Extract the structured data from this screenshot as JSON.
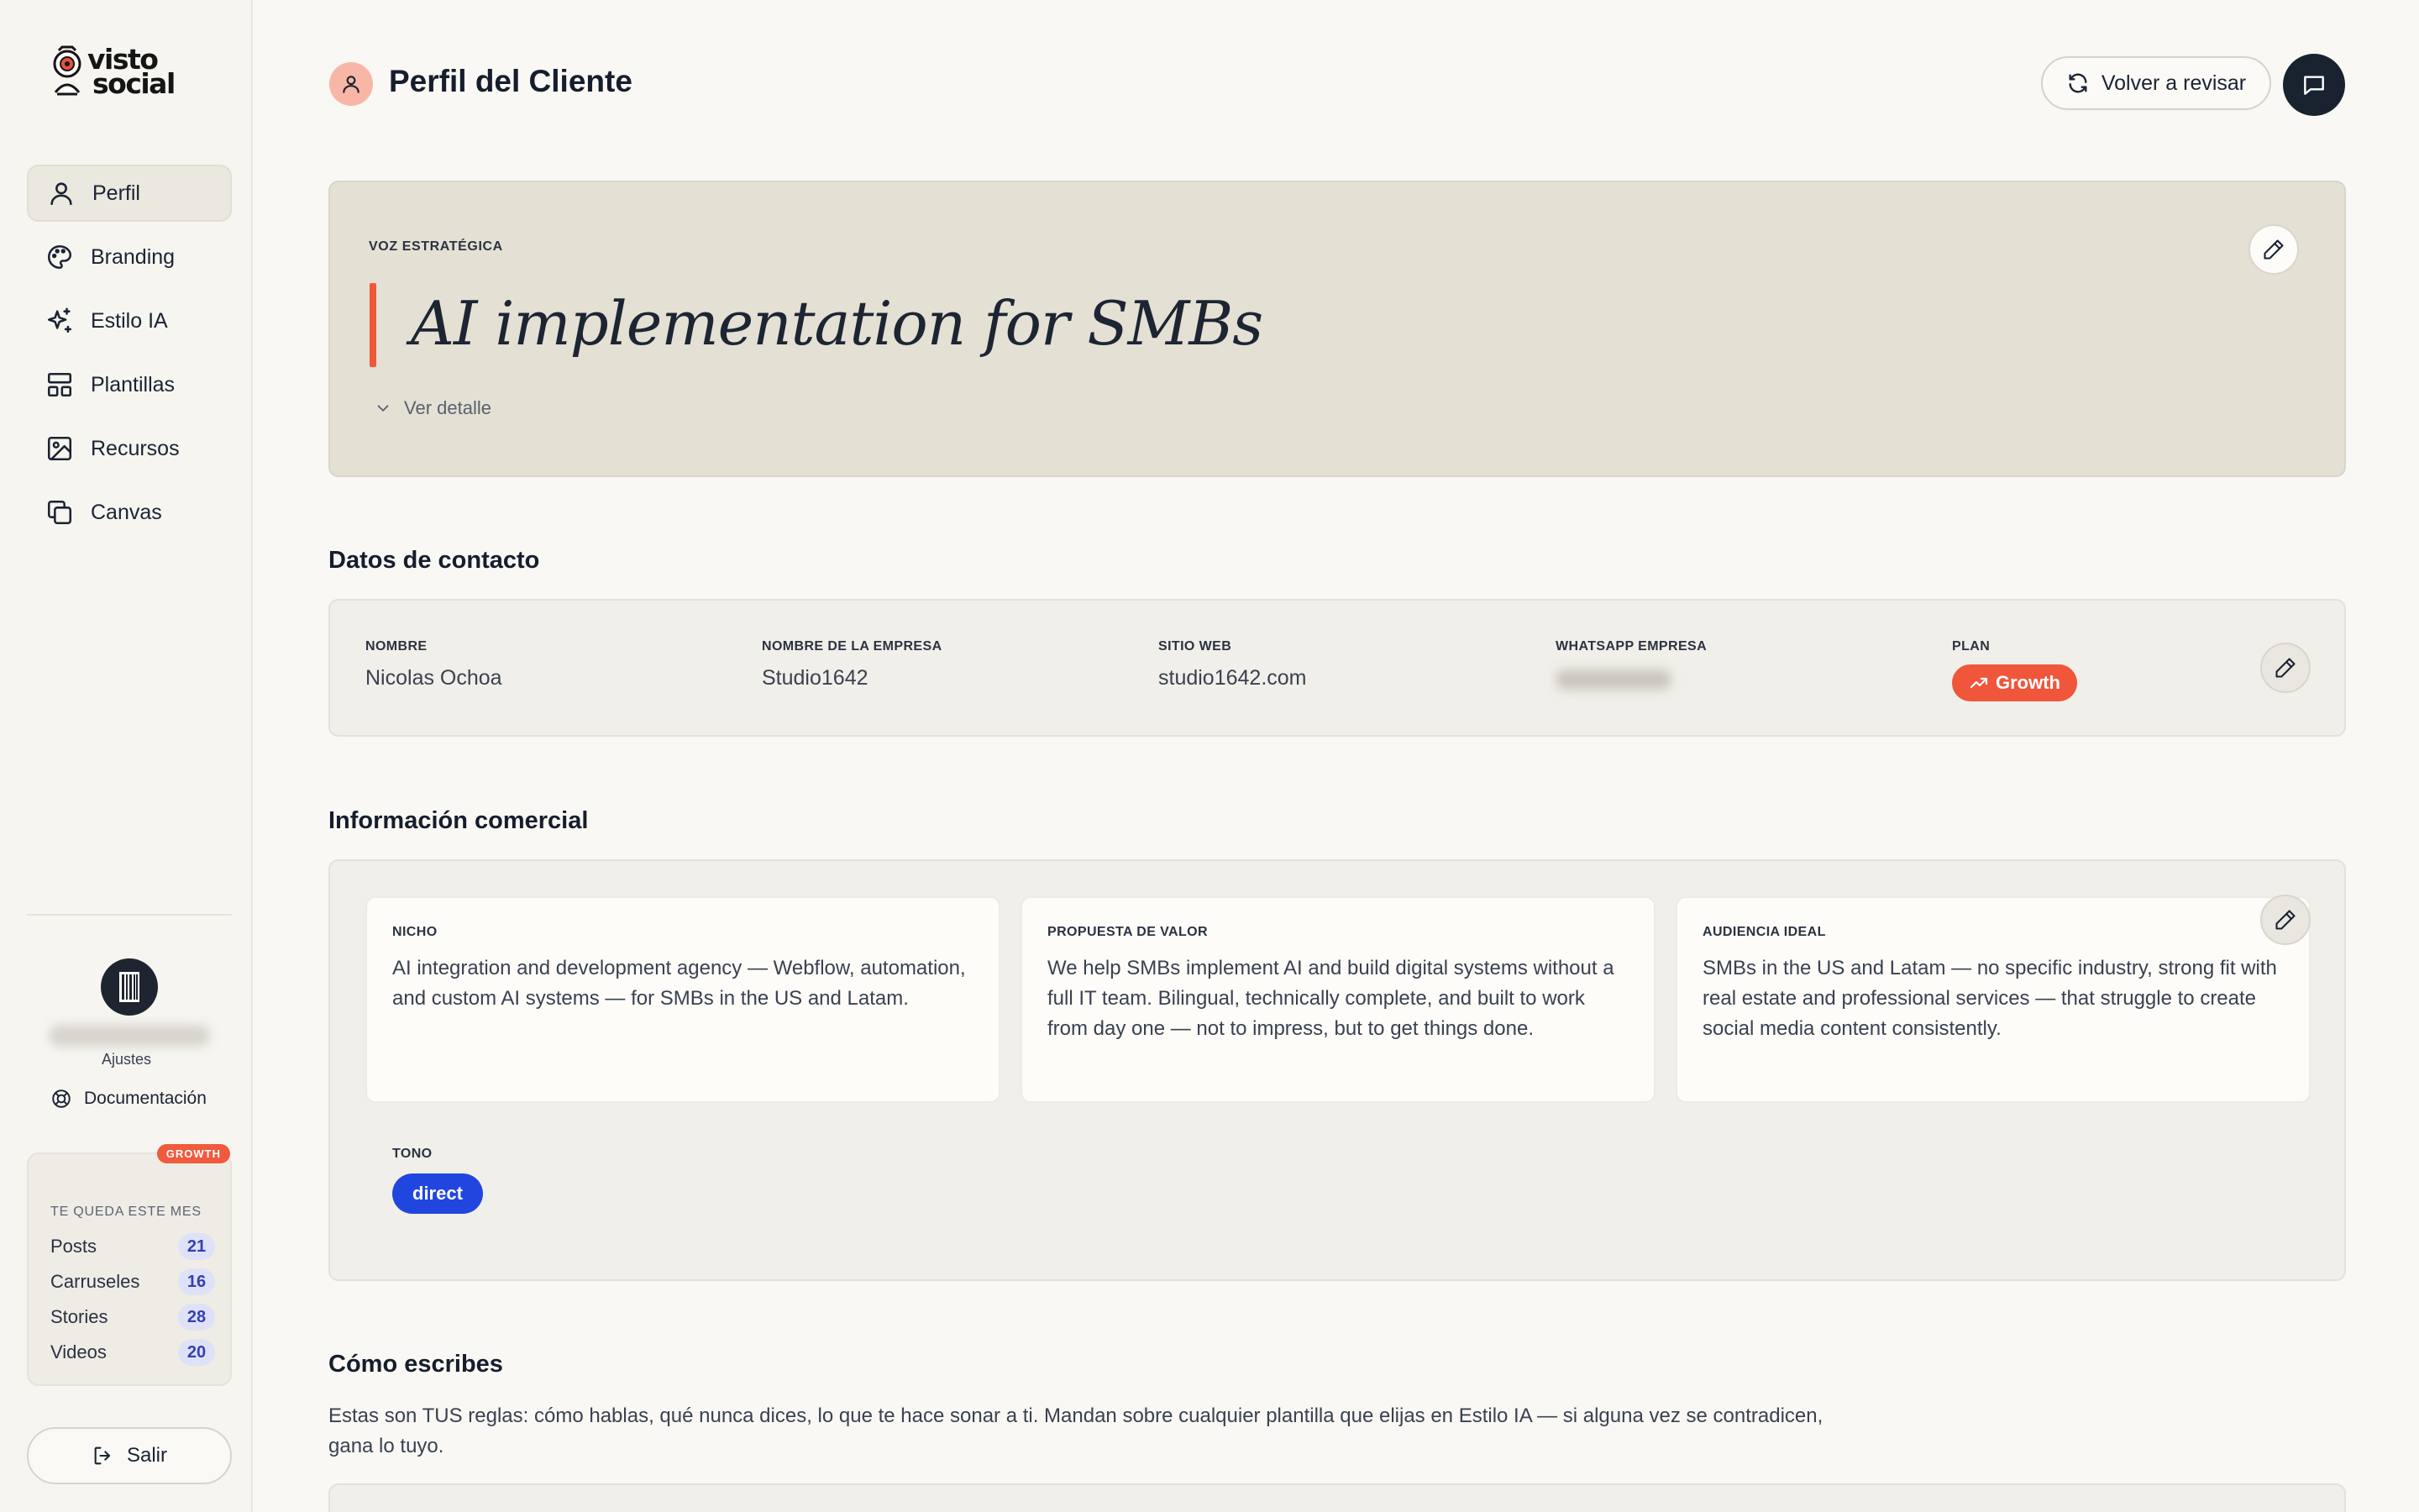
{
  "brand": {
    "line1": "visto",
    "line2": "social",
    "logo_icon": "camera-mascot-icon"
  },
  "sidebar": {
    "items": [
      {
        "label": "Perfil",
        "icon": "user-icon",
        "active": true
      },
      {
        "label": "Branding",
        "icon": "palette-icon"
      },
      {
        "label": "Estilo IA",
        "icon": "sparkles-icon"
      },
      {
        "label": "Plantillas",
        "icon": "layout-icon"
      },
      {
        "label": "Recursos",
        "icon": "image-icon"
      },
      {
        "label": "Canvas",
        "icon": "copy-icon"
      }
    ],
    "settings_label": "Ajustes",
    "docs_label": "Documentación",
    "quota": {
      "badge": "GROWTH",
      "title": "TE QUEDA ESTE MES",
      "rows": [
        {
          "label": "Posts",
          "count": "21"
        },
        {
          "label": "Carruseles",
          "count": "16"
        },
        {
          "label": "Stories",
          "count": "28"
        },
        {
          "label": "Videos",
          "count": "20"
        }
      ]
    },
    "logout_label": "Salir"
  },
  "header": {
    "title": "Perfil del Cliente",
    "review_label": "Volver a revisar"
  },
  "voice": {
    "eyebrow": "VOZ ESTRATÉGICA",
    "text": "AI implementation for SMBs",
    "detail_label": "Ver detalle"
  },
  "contact": {
    "title": "Datos de contacto",
    "fields": [
      {
        "label": "NOMBRE",
        "value": "Nicolas Ochoa"
      },
      {
        "label": "NOMBRE DE LA EMPRESA",
        "value": "Studio1642"
      },
      {
        "label": "SITIO WEB",
        "value": "studio1642.com"
      },
      {
        "label": "WHATSAPP EMPRESA"
      },
      {
        "label": "PLAN",
        "value": "Growth"
      }
    ]
  },
  "commercial": {
    "title": "Información comercial",
    "boxes": [
      {
        "label": "NICHO",
        "value": "AI integration and development agency — Webflow, automation, and custom AI systems — for SMBs in the US and Latam."
      },
      {
        "label": "PROPUESTA DE VALOR",
        "value": "We help SMBs implement AI and build digital systems without a full IT team. Bilingual, technically complete, and built to work from day one — not to impress, but to get things done."
      },
      {
        "label": "AUDIENCIA IDEAL",
        "value": "SMBs in the US and Latam — no specific industry, strong fit with real estate and professional services — that struggle to create social media content consistently."
      }
    ],
    "tone_label": "TONO",
    "tone_value": "direct"
  },
  "writing": {
    "title": "Cómo escribes",
    "description": "Estas son TUS reglas: cómo hablas, qué nunca dices, lo que te hace sonar a ti. Mandan sobre cualquier plantilla que elijas en Estilo IA — si alguna vez se contradicen, gana lo tuyo."
  },
  "colors": {
    "accent": "#f0563a",
    "tone_pill": "#2146e0",
    "dark": "#192330",
    "background": "#f9f8f4"
  }
}
